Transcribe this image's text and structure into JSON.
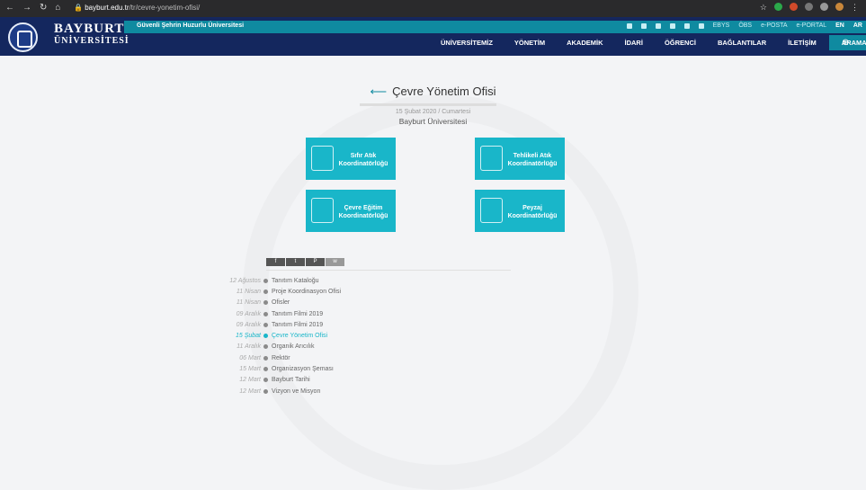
{
  "browser": {
    "url_host": "bayburt.edu.tr",
    "url_path": "/tr/cevre-yonetim-ofisi/"
  },
  "brand": {
    "name": "BAYBURT",
    "sub": "ÜNİVERSİTESİ"
  },
  "topbar": {
    "slogan": "Güvenli Şehrin Huzurlu Üniversitesi",
    "links": [
      "EBYS",
      "ÖBS",
      "e-POSTA",
      "e-PORTAL",
      "EN",
      "AR"
    ]
  },
  "nav": {
    "items": [
      "ÜNİVERSİTEMİZ",
      "YÖNETİM",
      "AKADEMİK",
      "İDARİ",
      "ÖĞRENCİ",
      "BAĞLANTILAR",
      "İLETİŞİM"
    ],
    "search": "ARAMA"
  },
  "page": {
    "title": "Çevre Yönetim Ofisi",
    "date": "15 Şubat 2020 / Cumartesi",
    "author": "Bayburt Üniversitesi"
  },
  "cards": [
    {
      "label": "Sıfır Atık Koordinatörlüğü",
      "icon": "recycle-icon"
    },
    {
      "label": "Tehlikeli Atık Koordinatörlüğü",
      "icon": "hazard-waste-icon"
    },
    {
      "label": "Çevre Eğitim Koordinatörlüğü",
      "icon": "education-board-icon"
    },
    {
      "label": "Peyzaj Koordinatörlüğü",
      "icon": "landscape-icon"
    }
  ],
  "share": [
    "f",
    "t",
    "P",
    "w"
  ],
  "timeline": [
    {
      "date": "12 Ağustos",
      "title": "Tanıtım Kataloğu"
    },
    {
      "date": "11 Nisan",
      "title": "Proje Koordinasyon Ofisi"
    },
    {
      "date": "11 Nisan",
      "title": "Ofisler"
    },
    {
      "date": "09 Aralık",
      "title": "Tanıtım Filmi 2019"
    },
    {
      "date": "09 Aralık",
      "title": "Tanıtım Filmi 2019"
    },
    {
      "date": "15 Şubat",
      "title": "Çevre Yönetim Ofisi"
    },
    {
      "date": "11 Aralık",
      "title": "Organik Arıcılık"
    },
    {
      "date": "06 Mart",
      "title": "Rektör"
    },
    {
      "date": "15 Mart",
      "title": "Organizasyon Şeması"
    },
    {
      "date": "12 Mart",
      "title": "Bayburt Tarihi"
    },
    {
      "date": "12 Mart",
      "title": "Vizyon ve Misyon"
    }
  ]
}
